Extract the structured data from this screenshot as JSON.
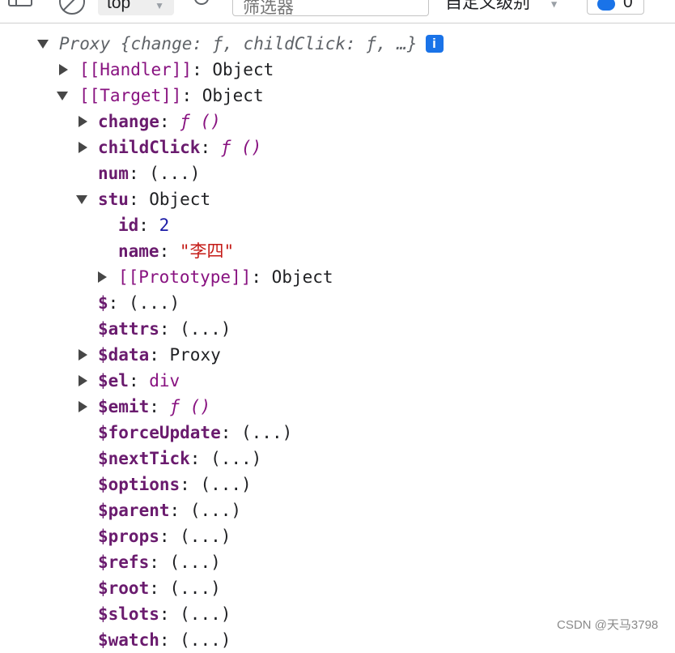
{
  "toolbar": {
    "context": "top",
    "filter_placeholder": "筛选器",
    "levels": "自定义级别",
    "issues_count": "0"
  },
  "tree": {
    "root": {
      "summary": "Proxy {change: ƒ, childClick: ƒ, …}"
    },
    "handler": {
      "key": "[[Handler]]",
      "value": "Object"
    },
    "target": {
      "key": "[[Target]]",
      "value": "Object"
    },
    "target_props": {
      "change": {
        "key": "change",
        "value": "ƒ ()"
      },
      "childClick": {
        "key": "childClick",
        "value": "ƒ ()"
      },
      "num": {
        "key": "num",
        "value": "(...)"
      },
      "stu": {
        "key": "stu",
        "value": "Object"
      },
      "dollar": {
        "key": "$",
        "value": "(...)"
      },
      "attrs": {
        "key": "$attrs",
        "value": "(...)"
      },
      "data": {
        "key": "$data",
        "value": "Proxy"
      },
      "el": {
        "key": "$el",
        "value": "div"
      },
      "emit": {
        "key": "$emit",
        "value": "ƒ ()"
      },
      "forceUpdate": {
        "key": "$forceUpdate",
        "value": "(...)"
      },
      "nextTick": {
        "key": "$nextTick",
        "value": "(...)"
      },
      "options": {
        "key": "$options",
        "value": "(...)"
      },
      "parent": {
        "key": "$parent",
        "value": "(...)"
      },
      "props": {
        "key": "$props",
        "value": "(...)"
      },
      "refs": {
        "key": "$refs",
        "value": "(...)"
      },
      "root": {
        "key": "$root",
        "value": "(...)"
      },
      "slots": {
        "key": "$slots",
        "value": "(...)"
      },
      "watch": {
        "key": "$watch",
        "value": "(...)"
      }
    },
    "stu_props": {
      "id": {
        "key": "id",
        "value": "2"
      },
      "name": {
        "key": "name",
        "value": "\"李四\""
      },
      "prototype": {
        "key": "[[Prototype]]",
        "value": "Object"
      }
    }
  },
  "watermark": "CSDN @天马3798"
}
